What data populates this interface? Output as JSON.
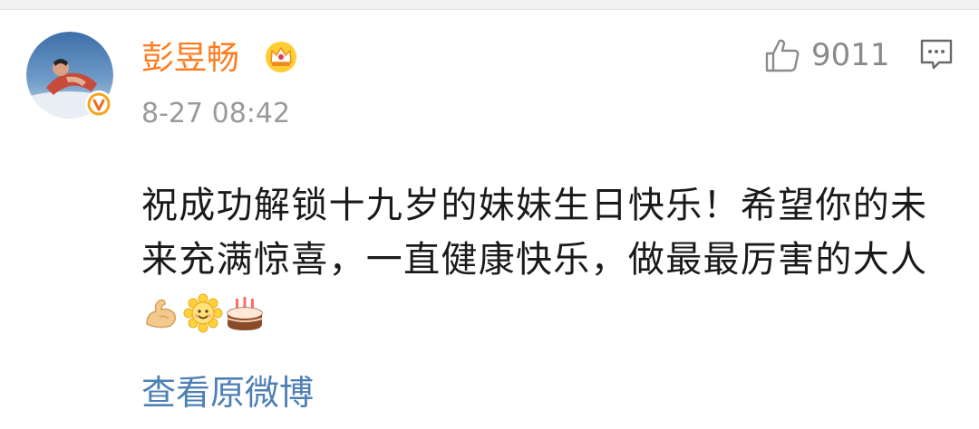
{
  "comment": {
    "author": {
      "name": "彭昱畅",
      "avatar_icon": "avatar-photo",
      "verified_icon": "verified-v-badge-icon",
      "member_icon": "crown-icon"
    },
    "timestamp": "8-27 08:42",
    "likes": {
      "icon": "thumbs-up-icon",
      "count": "9011"
    },
    "reply_icon": "comment-bubble-icon",
    "text": "祝成功解锁十九岁的妹妹生日快乐！希望你的未来充满惊喜，一直健康快乐，做最最厉害的大人",
    "emojis": [
      "flexed-biceps-icon",
      "sunflower-face-icon",
      "birthday-cake-icon"
    ],
    "view_original": "查看原微博"
  },
  "colors": {
    "username": "#ff7c1e",
    "link": "#4e7fb5",
    "meta": "#9a9a9a",
    "text": "#1a1a1a"
  }
}
